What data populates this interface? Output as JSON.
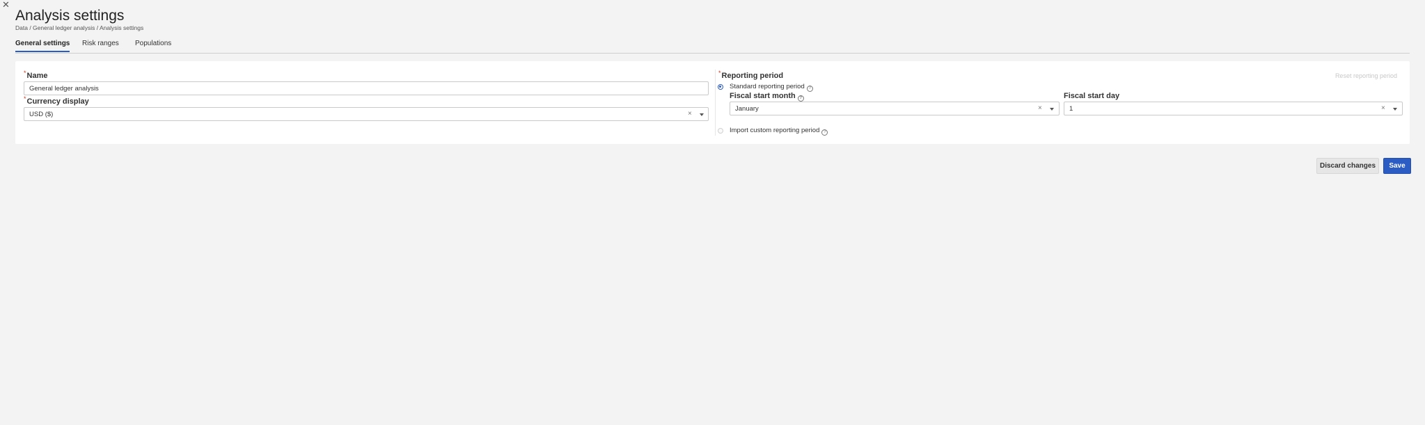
{
  "header": {
    "close_icon": "close-icon",
    "title": "Analysis settings",
    "breadcrumb": "Data / General ledger analysis / Analysis settings"
  },
  "tabs": [
    {
      "label": "General settings",
      "active": true
    },
    {
      "label": "Risk ranges",
      "active": false
    },
    {
      "label": "Populations",
      "active": false
    }
  ],
  "form": {
    "required_mark": "*",
    "name": {
      "label": "Name",
      "value": "General ledger analysis"
    },
    "currency": {
      "label": "Currency display",
      "value": "USD ($)",
      "clear_glyph": "×"
    },
    "reporting_period": {
      "label": "Reporting period",
      "reset_label": "Reset reporting period",
      "standard_option": {
        "label": "Standard reporting period",
        "selected": true
      },
      "fiscal_start_month": {
        "label": "Fiscal start month",
        "value": "January"
      },
      "fiscal_start_day": {
        "label": "Fiscal start day",
        "value": "1"
      },
      "custom_option": {
        "label": "Import custom reporting period",
        "selected": false
      }
    }
  },
  "actions": {
    "discard_label": "Discard changes",
    "save_label": "Save"
  },
  "colors": {
    "accent": "#2b5cc4",
    "required": "#d4351c",
    "background": "#f3f3f3"
  }
}
